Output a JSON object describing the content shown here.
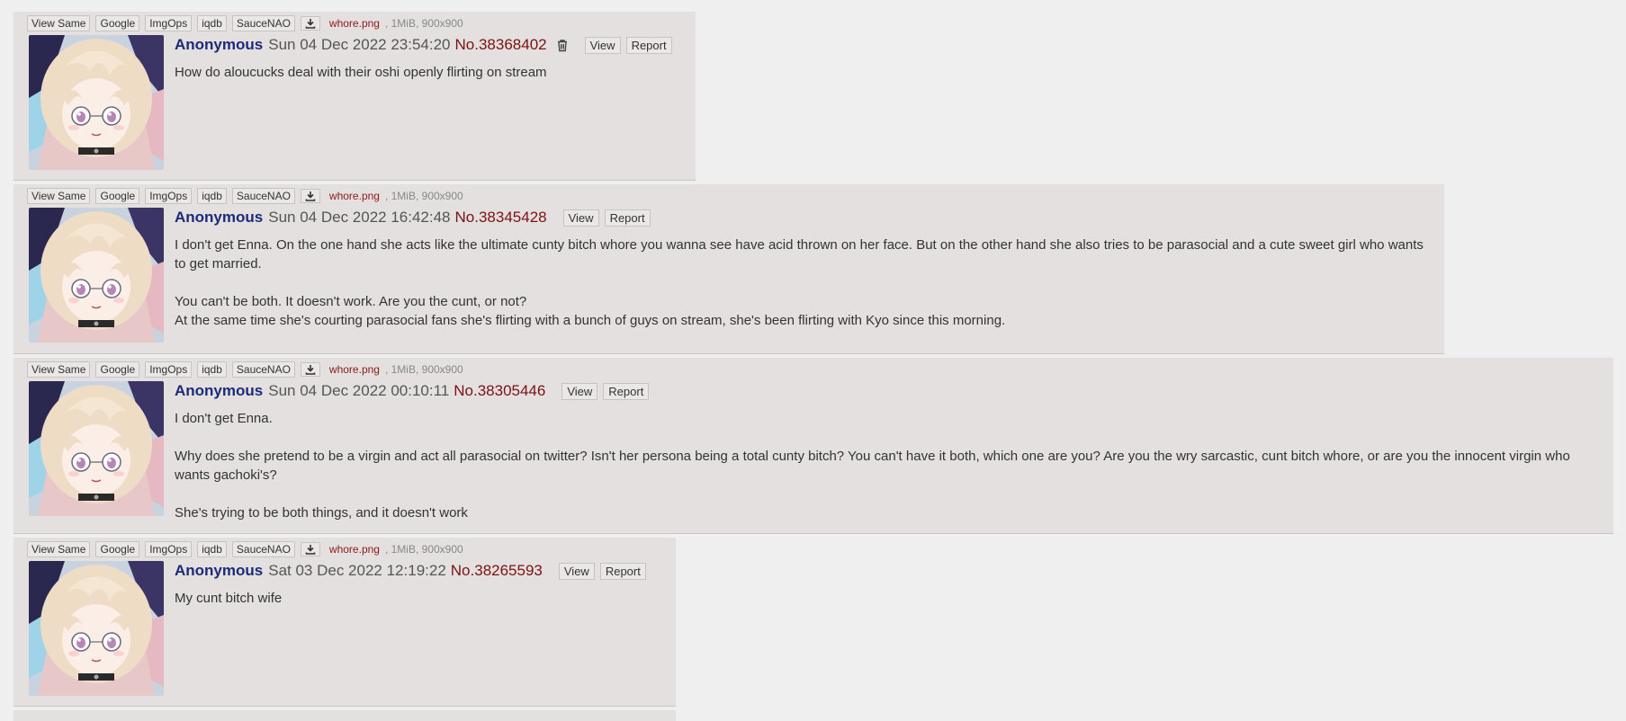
{
  "toolbar": {
    "view_same": "View Same",
    "google": "Google",
    "imgops": "ImgOps",
    "iqdb": "iqdb",
    "saucenao": "SauceNAO",
    "download_icon": "download-icon"
  },
  "file": {
    "name": "whore.png",
    "meta": ", 1MiB, 900x900"
  },
  "buttons": {
    "view": "View",
    "report": "Report"
  },
  "posts": [
    {
      "author": "Anonymous",
      "date": "Sun 04 Dec 2022 23:54:20",
      "number": "No.38368402",
      "body": [
        "How do aloucucks deal with their oshi openly flirting on stream"
      ]
    },
    {
      "author": "Anonymous",
      "date": "Sun 04 Dec 2022 16:42:48",
      "number": "No.38345428",
      "body": [
        "I don't get Enna. On the one hand she acts like the ultimate cunty bitch whore you wanna see have acid thrown on her face. But on the other hand she also tries to be parasocial and a cute sweet girl who wants to get married.",
        "",
        "You can't be both. It doesn't work. Are you the cunt, or not?",
        "At the same time she's courting parasocial fans she's flirting with a bunch of guys on stream, she's been flirting with Kyo since this morning."
      ]
    },
    {
      "author": "Anonymous",
      "date": "Sun 04 Dec 2022 00:10:11",
      "number": "No.38305446",
      "body": [
        "I don't get Enna.",
        "",
        "Why does she pretend to be a virgin and act all parasocial on twitter? Isn't her persona being a total cunty bitch? You can't have it both, which one are you? Are you the wry sarcastic, cunt bitch whore, or are you the innocent virgin who wants gachoki's?",
        "",
        "She's trying to be both things, and it doesn't work"
      ]
    },
    {
      "author": "Anonymous",
      "date": "Sat 03 Dec 2022 12:19:22",
      "number": "No.38265593",
      "body": [
        "My cunt bitch wife"
      ]
    }
  ]
}
